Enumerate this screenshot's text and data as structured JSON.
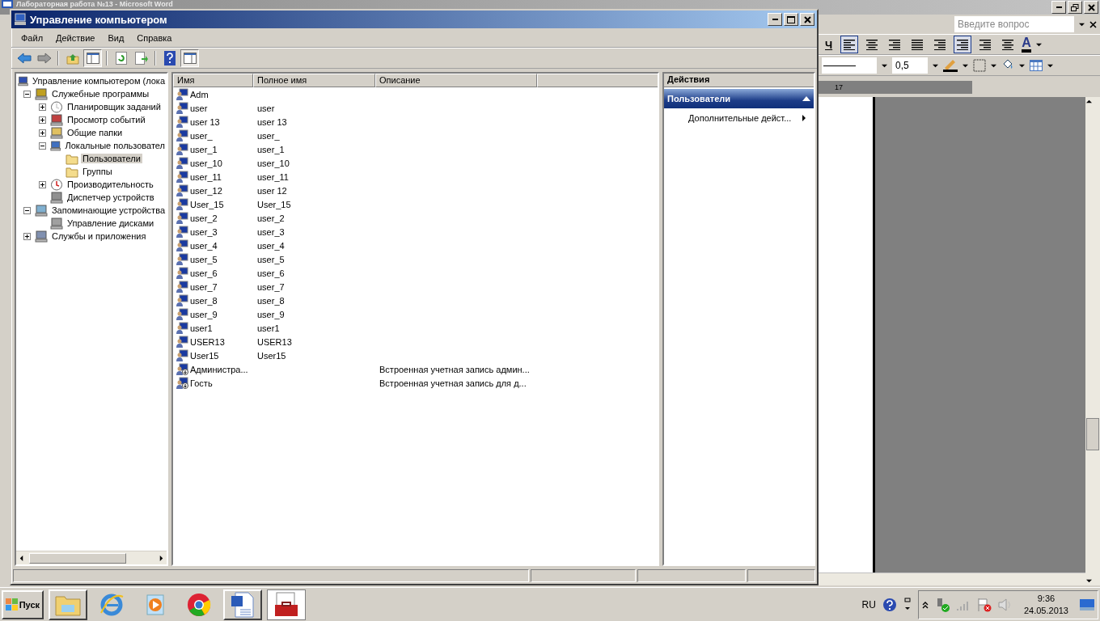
{
  "background_window": {
    "title": "Лабораторная работа №13 - Microsoft Word",
    "help_placeholder": "Введите вопрос",
    "underline_key": "Ч",
    "font_color_key": "A",
    "line_weight": "0,5",
    "ruler_mark": "17"
  },
  "window": {
    "title": "Управление компьютером"
  },
  "menu": [
    "Файл",
    "Действие",
    "Вид",
    "Справка"
  ],
  "toolbar": [
    [
      {
        "kind": "back",
        "pressed": false
      },
      {
        "kind": "forward",
        "pressed": false
      }
    ],
    [
      {
        "kind": "up",
        "pressed": false
      },
      {
        "kind": "tree",
        "pressed": true
      }
    ],
    [
      {
        "kind": "refresh",
        "pressed": false
      },
      {
        "kind": "export",
        "pressed": false
      }
    ],
    [
      {
        "kind": "help",
        "pressed": false
      },
      {
        "kind": "pane",
        "pressed": true
      }
    ]
  ],
  "tree": [
    {
      "label": "Управление компьютером (лока",
      "selected": false,
      "children": [
        {
          "label": "Служебные программы",
          "expanded": true,
          "selected": false,
          "children": [
            {
              "label": "Планировщик заданий",
              "expanded": false,
              "selected": false
            },
            {
              "label": "Просмотр событий",
              "expanded": false,
              "selected": false
            },
            {
              "label": "Общие папки",
              "expanded": false,
              "selected": false
            },
            {
              "label": "Локальные пользовател",
              "expanded": true,
              "selected": false,
              "children": [
                {
                  "label": "Пользователи",
                  "selected": true
                },
                {
                  "label": "Группы",
                  "selected": false
                }
              ]
            },
            {
              "label": "Производительность",
              "expanded": false,
              "selected": false
            },
            {
              "label": "Диспетчер устройств",
              "selected": false
            }
          ]
        },
        {
          "label": "Запоминающие устройства",
          "expanded": true,
          "selected": false,
          "children": [
            {
              "label": "Управление дисками",
              "selected": false
            }
          ]
        },
        {
          "label": "Службы и приложения",
          "expanded": false,
          "selected": false
        }
      ]
    }
  ],
  "table": {
    "columns": [
      "Имя",
      "Полное имя",
      "Описание"
    ],
    "rows": [
      {
        "name": "Adm",
        "full_name": "",
        "description": "",
        "disabled": false
      },
      {
        "name": "user",
        "full_name": "user",
        "description": "",
        "disabled": false
      },
      {
        "name": "user 13",
        "full_name": "user 13",
        "description": "",
        "disabled": false
      },
      {
        "name": "user_",
        "full_name": "user_",
        "description": "",
        "disabled": false
      },
      {
        "name": "user_1",
        "full_name": "user_1",
        "description": "",
        "disabled": false
      },
      {
        "name": "user_10",
        "full_name": "user_10",
        "description": "",
        "disabled": false
      },
      {
        "name": "user_11",
        "full_name": "user_11",
        "description": "",
        "disabled": false
      },
      {
        "name": "user_12",
        "full_name": "user 12",
        "description": "",
        "disabled": false
      },
      {
        "name": "User_15",
        "full_name": "User_15",
        "description": "",
        "disabled": false
      },
      {
        "name": "user_2",
        "full_name": "user_2",
        "description": "",
        "disabled": false
      },
      {
        "name": "user_3",
        "full_name": "user_3",
        "description": "",
        "disabled": false
      },
      {
        "name": "user_4",
        "full_name": "user_4",
        "description": "",
        "disabled": false
      },
      {
        "name": "user_5",
        "full_name": "user_5",
        "description": "",
        "disabled": false
      },
      {
        "name": "user_6",
        "full_name": "user_6",
        "description": "",
        "disabled": false
      },
      {
        "name": "user_7",
        "full_name": "user_7",
        "description": "",
        "disabled": false
      },
      {
        "name": "user_8",
        "full_name": "user_8",
        "description": "",
        "disabled": false
      },
      {
        "name": "user_9",
        "full_name": "user_9",
        "description": "",
        "disabled": false
      },
      {
        "name": "user1",
        "full_name": "user1",
        "description": "",
        "disabled": false
      },
      {
        "name": "USER13",
        "full_name": "USER13",
        "description": "",
        "disabled": false
      },
      {
        "name": "User15",
        "full_name": "User15",
        "description": "",
        "disabled": false
      },
      {
        "name": "Администра...",
        "full_name": "",
        "description": "Встроенная учетная запись админ...",
        "disabled": true
      },
      {
        "name": "Гость",
        "full_name": "",
        "description": "Встроенная учетная запись для д...",
        "disabled": true
      }
    ]
  },
  "actions": {
    "title": "Действия",
    "section": {
      "title": "Пользователи",
      "expanded": true
    },
    "items": [
      "Дополнительные дейст..."
    ]
  },
  "taskbar": {
    "start": "Пуск",
    "apps": [
      {
        "kind": "explorer",
        "active": false
      },
      {
        "kind": "browser",
        "active": false
      },
      {
        "kind": "player",
        "active": false
      },
      {
        "kind": "chrome",
        "active": false
      },
      {
        "kind": "word",
        "active": false
      },
      {
        "kind": "toolbox",
        "active": true
      }
    ],
    "language": "RU",
    "time": "9:36",
    "date": "24.05.2013"
  }
}
